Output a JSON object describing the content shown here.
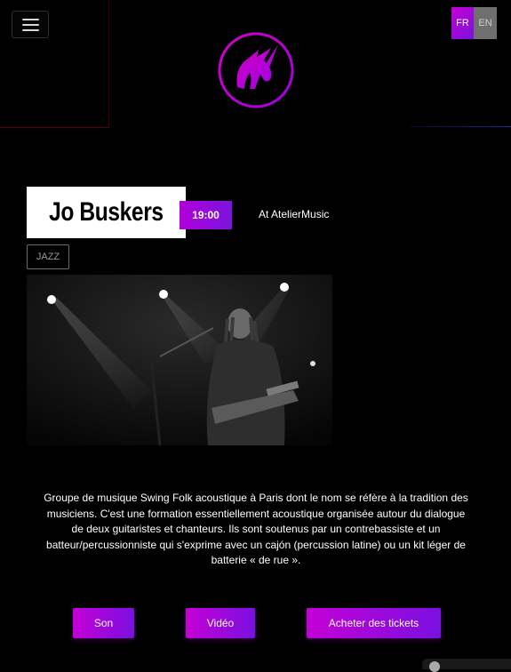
{
  "header": {
    "menu_icon": "hamburger-icon",
    "logo_icon": "unicorn-logo-icon",
    "languages": [
      {
        "label": "FR",
        "active": true
      },
      {
        "label": "EN",
        "active": false
      }
    ]
  },
  "event": {
    "name": "Jo Buskers",
    "time": "19:00",
    "venue": "At AtelierMusic",
    "genre": "JAZZ",
    "description": "Groupe de musique Swing Folk acoustique à Paris dont le nom se réfère à la tradition des musiciens. C'est une formation essentiellement acoustique organisée autour du dialogue de deux guitaristes et chanteurs. Ils sont soutenus par un contrebassiste et un batteur/percussionniste qui s'exprime avec un cajón (percussion latine) ou un kit léger de batterie « de rue »."
  },
  "actions": {
    "sound": "Son",
    "video": "Vidéo",
    "tickets": "Acheter des tickets"
  },
  "colors": {
    "accent_start": "#c400d6",
    "accent_end": "#7a10e0",
    "background": "#000000"
  }
}
